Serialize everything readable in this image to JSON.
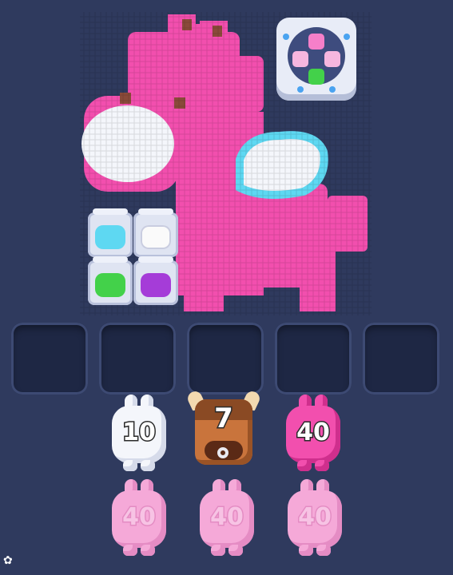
{
  "game": {
    "picture": "pink pixel pegasus",
    "colors": {
      "pink": "#f24fae",
      "pink_faded": "#f5a9d8",
      "white": "#f4f6fb",
      "cyan": "#5ed8f2",
      "green": "#43d14a",
      "purple": "#a53cd8",
      "slot_bg": "#1e2744",
      "background": "#2f3a5e"
    }
  },
  "bean_jars": [
    {
      "color_name": "cyan",
      "color": "#5ed8f2"
    },
    {
      "color_name": "white",
      "color": "#f4f6fb"
    },
    {
      "color_name": "green",
      "color": "#43d14a"
    },
    {
      "color_name": "purple",
      "color": "#a53cd8"
    }
  ],
  "powerup": {
    "icon": "block-swap-icon"
  },
  "slots": [
    {},
    {},
    {},
    {},
    {}
  ],
  "queue": {
    "row1": [
      {
        "kind": "white-pig",
        "count": "10"
      },
      {
        "kind": "bull",
        "count": "7"
      },
      {
        "kind": "pink-pig",
        "count": "40"
      }
    ],
    "row2": [
      {
        "kind": "pink-pig",
        "count": "40"
      },
      {
        "kind": "pink-pig",
        "count": "40"
      },
      {
        "kind": "pink-pig",
        "count": "40"
      }
    ]
  },
  "settings": {
    "icon": "gear-icon"
  }
}
